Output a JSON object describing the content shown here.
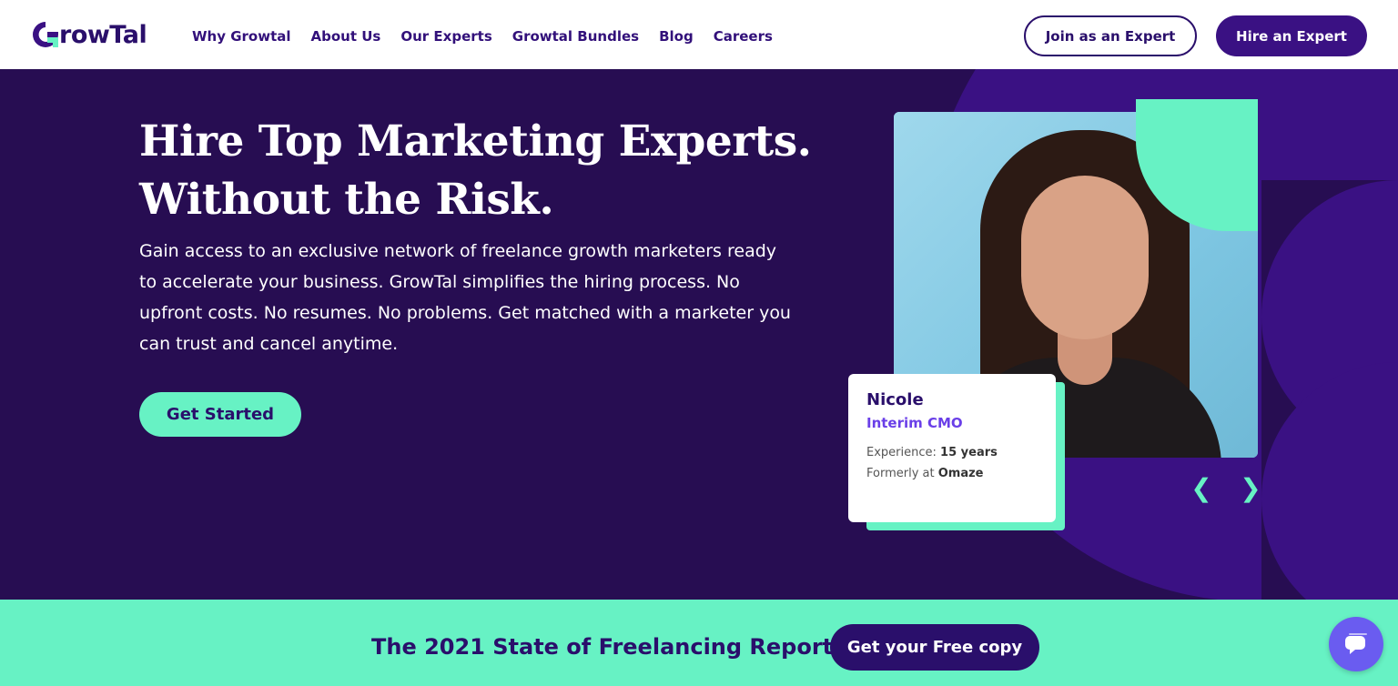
{
  "header": {
    "logo_text": "rowTal",
    "nav": [
      "Why Growtal",
      "About Us",
      "Our Experts",
      "Growtal Bundles",
      "Blog",
      "Careers"
    ],
    "join_label": "Join as an Expert",
    "hire_label": "Hire an Expert"
  },
  "hero": {
    "title_line1": "Hire Top Marketing Experts.",
    "title_line2": "Without the Risk.",
    "description": "Gain access to an exclusive network of freelance growth marketers ready to accelerate your business. GrowTal simplifies the hiring process. No upfront costs. No resumes. No problems. Get matched with a marketer you can trust and cancel anytime.",
    "cta_label": "Get Started",
    "expert": {
      "name": "Nicole",
      "role": "Interim CMO",
      "experience_label": "Experience:",
      "experience_value": "15 years",
      "formerly_label": "Formerly at",
      "formerly_value": "Omaze"
    },
    "prev_arrow": "❮",
    "next_arrow": "❯"
  },
  "banner": {
    "text": "The 2021 State of Freelancing Report",
    "cta_label": "Get your Free copy"
  },
  "colors": {
    "brand_dark": "#2a0f6b",
    "hero_bg": "#270d52",
    "accent_mint": "#67f2c4",
    "accent_purple": "#6a3fe8"
  },
  "icons": {
    "logo": "growtal-logo-icon",
    "chat": "chat-bubble-icon"
  }
}
